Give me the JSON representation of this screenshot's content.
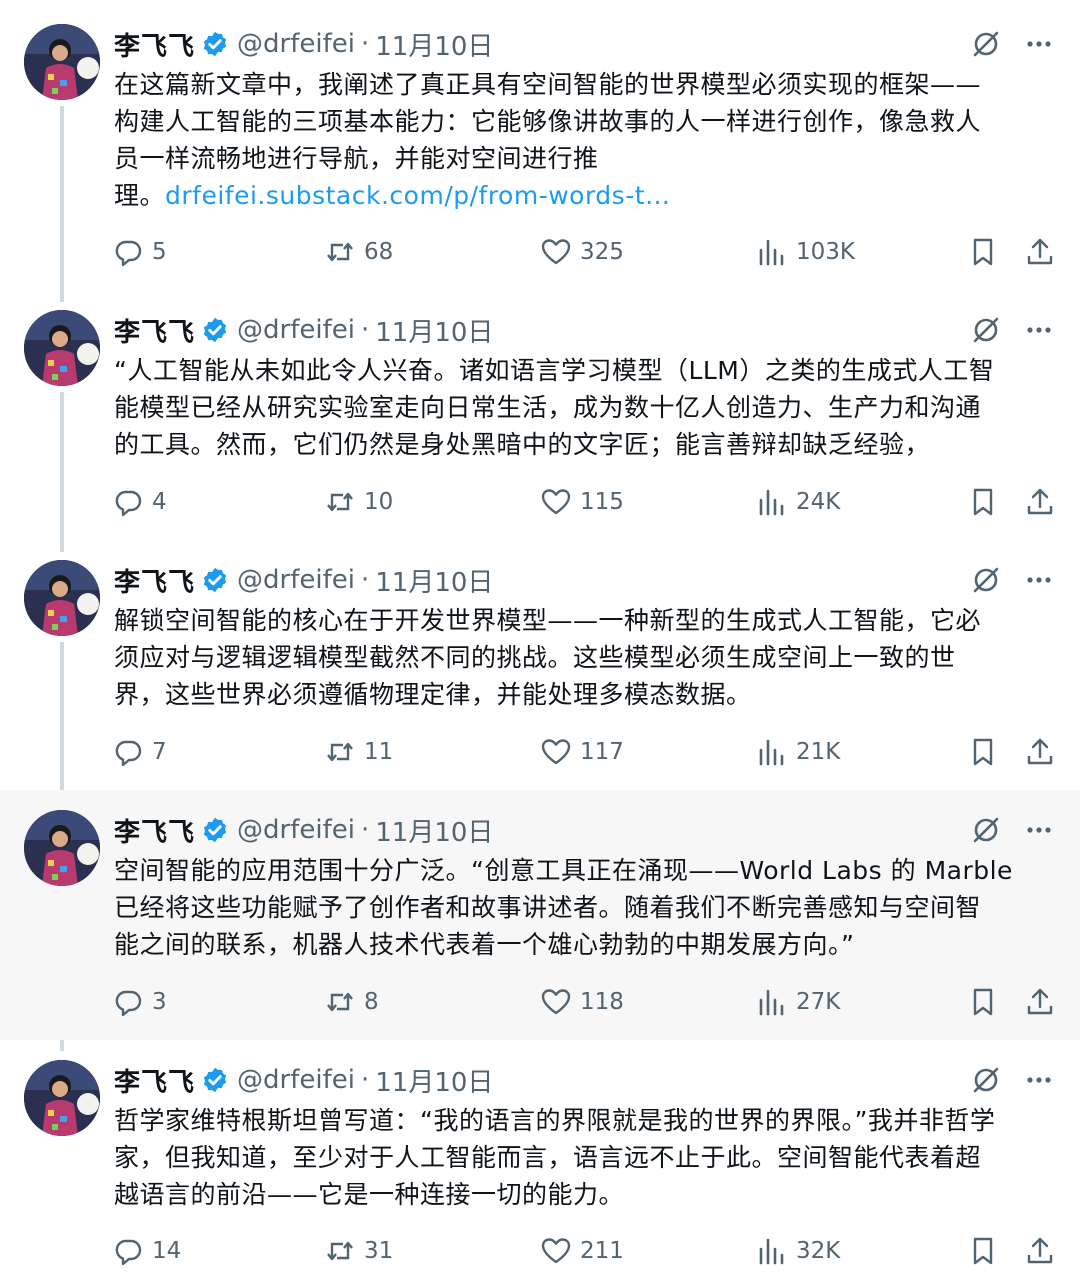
{
  "author": {
    "name": "李飞飞",
    "handle": "@drfeifei",
    "separator": "·",
    "date": "11月10日"
  },
  "colors": {
    "text": "#0f1419",
    "secondary": "#536471",
    "link": "#1d9bf0",
    "verified": "#1d9bf0",
    "thread_line": "#cfd9de",
    "highlight_bg": "#f7f7f7"
  },
  "icons": {
    "verified": "verified-badge-icon",
    "grok": "grok-icon",
    "more": "more-dots-icon",
    "reply": "reply-icon",
    "repost": "repost-icon",
    "like": "heart-icon",
    "views": "views-bar-chart-icon",
    "bookmark": "bookmark-icon",
    "share": "share-icon"
  },
  "tweets": [
    {
      "lines": [
        "在这篇新文章中，我阐述了真正具有空间智能的世界模型必须实现的框架——",
        "构建人工智能的三项基本能力：它能够像讲故事的人一样进行创作，像急救人",
        "员一样流畅地进行导航，并能对空间进行推",
        "理。"
      ],
      "link": "drfeifei.substack.com/p/from-words-t…",
      "replies": "5",
      "reposts": "68",
      "likes": "325",
      "views": "103K"
    },
    {
      "lines": [
        "“人工智能从未如此令人兴奋。诸如语言学习模型（LLM）之类的生成式人工智",
        "能模型已经从研究实验室走向日常生活，成为数十亿人创造力、生产力和沟通",
        "的工具。然而，它们仍然是身处黑暗中的文字匠；能言善辩却缺乏经验，"
      ],
      "replies": "4",
      "reposts": "10",
      "likes": "115",
      "views": "24K"
    },
    {
      "lines": [
        "解锁空间智能的核心在于开发世界模型——一种新型的生成式人工智能，它必",
        "须应对与逻辑逻辑模型截然不同的挑战。这些模型必须生成空间上一致的世",
        "界，这些世界必须遵循物理定律，并能处理多模态数据。"
      ],
      "replies": "7",
      "reposts": "11",
      "likes": "117",
      "views": "21K"
    },
    {
      "lines": [
        "空间智能的应用范围十分广泛。“创意工具正在涌现——World Labs 的 Marble",
        "已经将这些功能赋予了创作者和故事讲述者。随着我们不断完善感知与空间智",
        "能之间的联系，机器人技术代表着一个雄心勃勃的中期发展方向。”"
      ],
      "replies": "3",
      "reposts": "8",
      "likes": "118",
      "views": "27K"
    },
    {
      "lines": [
        "哲学家维特根斯坦曾写道：“我的语言的界限就是我的世界的界限。”我并非哲学",
        "家，但我知道，至少对于人工智能而言，语言远不止于此。空间智能代表着超",
        "越语言的前沿——它是一种连接一切的能力。"
      ],
      "replies": "14",
      "reposts": "31",
      "likes": "211",
      "views": "32K"
    }
  ]
}
